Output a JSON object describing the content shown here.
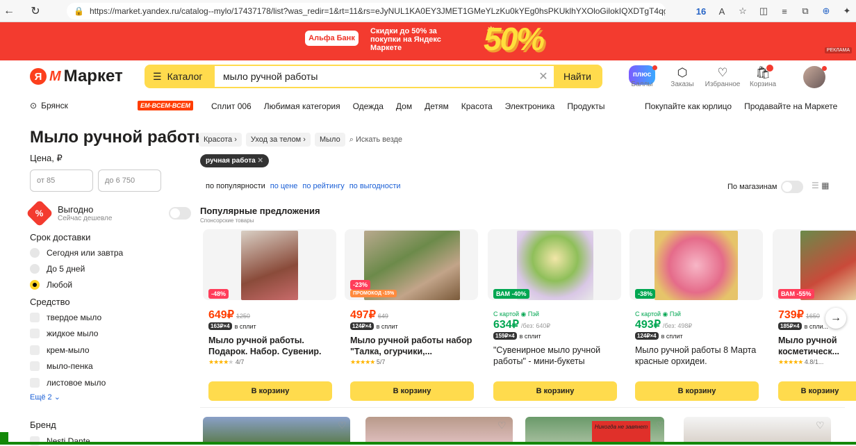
{
  "browser": {
    "url": "https://market.yandex.ru/catalog--mylo/17437178/list?was_redir=1&rt=11&rs=eJyNUL1KA0EY3JMET1GMeYLzKu0kYEg0hsPKUklhYXOloGilokIQXDTgT4qgT...",
    "badge_count": "16"
  },
  "banner": {
    "bank": "Альфа Банк",
    "text": "Скидки до 50% за покупки на Яндекс Маркете",
    "big": "50%",
    "small": "до",
    "ad_label": "РЕКЛАМА"
  },
  "header": {
    "logo_ya": "Я",
    "logo_text": "Маркет",
    "catalog_label": "Каталог",
    "search_value": "мыло ручной работы",
    "find_label": "Найти",
    "plus_label": "плюс",
    "icons": [
      {
        "name": "points",
        "label": "Баллы"
      },
      {
        "name": "orders",
        "label": "Заказы"
      },
      {
        "name": "favorites",
        "label": "Избранное"
      },
      {
        "name": "cart",
        "label": "Корзина"
      }
    ]
  },
  "nav": {
    "city": "Брянск",
    "promo": "EM-ВСЕМ-ВСЕМ",
    "links": [
      "Сплит 006",
      "Любимая категория",
      "Одежда",
      "Дом",
      "Детям",
      "Красота",
      "Электроника",
      "Продукты"
    ],
    "right_links": [
      "Покупайте как юрлицо",
      "Продавайте на Маркете"
    ]
  },
  "page": {
    "title": "Мыло ручной работы",
    "breadcrumbs": [
      "Красота",
      "Уход за телом",
      "Мыло"
    ],
    "search_everywhere": "Искать везде"
  },
  "filters": {
    "price_label": "Цена, ₽",
    "price_from": "от 85",
    "price_to": "до 6 750",
    "deal_title": "Выгодно",
    "deal_sub": "Сейчас дешевле",
    "delivery_label": "Срок доставки",
    "delivery_options": [
      "Сегодня или завтра",
      "До 5 дней",
      "Любой"
    ],
    "delivery_selected": "Любой",
    "type_label": "Средство",
    "types": [
      "твердое мыло",
      "жидкое мыло",
      "крем-мыло",
      "мыло-пенка",
      "листовое мыло"
    ],
    "more": "Ещё 2",
    "brand_label": "Бренд",
    "brand_first": "Nesti Dante"
  },
  "results": {
    "chip": "ручная работа",
    "sort": [
      "по популярности",
      "по цене",
      "по рейтингу",
      "по выгодности"
    ],
    "by_store": "По магазинам",
    "section_title": "Популярные предложения",
    "section_sub": "Спонсорские товары",
    "cart_label": "В корзину",
    "products": [
      {
        "discount": "-48%",
        "price": "649",
        "old": "1250",
        "split": "163₽×4",
        "split_text": "в сплит",
        "title": "Мыло ручной работы. Подарок. Набор. Сувенир.",
        "rating": "4/7"
      },
      {
        "discount": "-23%",
        "promo": "ПРОМОКОД -15%",
        "price": "497",
        "old": "649",
        "split": "124₽×4",
        "split_text": "в сплит",
        "title": "Мыло ручной работы набор \"Талка, огурчики,...",
        "rating": "5/7"
      },
      {
        "discount": "ВАМ -40%",
        "card": "С картой ◉ Пэй",
        "price": "634",
        "old": "/без: 640₽",
        "split": "159₽×4",
        "split_text": "в сплит",
        "title": "\"Сувенирное мыло ручной работы\" - мини-букеты",
        "rating": ""
      },
      {
        "discount": "-38%",
        "card": "С картой ◉ Пэй",
        "price": "493",
        "old": "/без: 498₽",
        "split": "124₽×4",
        "split_text": "в сплит",
        "title": "Мыло ручной работы 8 Марта красные орхидеи.",
        "rating": ""
      },
      {
        "discount": "ВАМ -55%",
        "price": "739",
        "old": "1650",
        "split": "185₽×4",
        "split_text": "в спли...",
        "title": "Мыло ручной косметическ...",
        "rating": "4.8/1..."
      }
    ],
    "row2_label": "Никогда не завянет"
  },
  "colors": {
    "accent": "#ffdb4d",
    "red": "#f33b2f",
    "link": "#1a5fd6"
  }
}
